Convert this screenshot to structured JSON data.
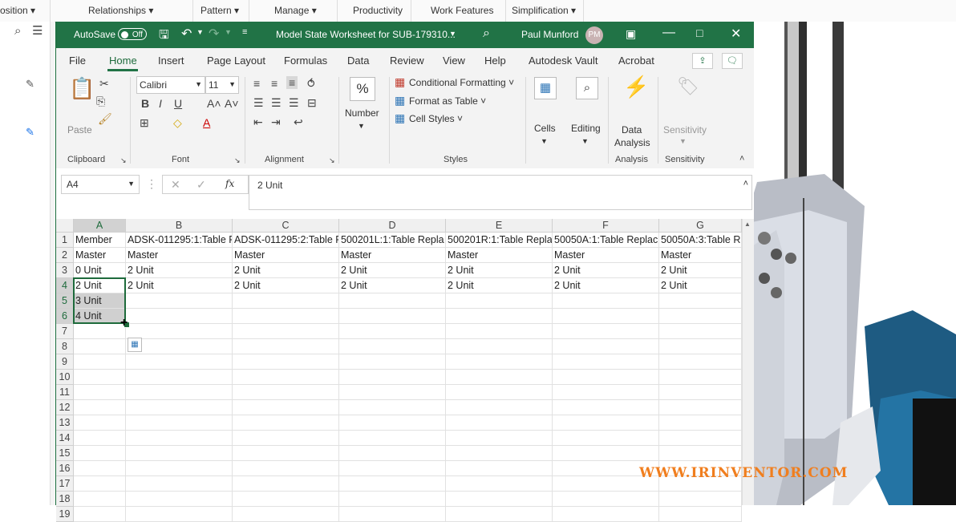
{
  "inventor": {
    "menu": [
      "osition",
      "Relationships",
      "Pattern",
      "Manage",
      "Productivity",
      "Work Features",
      "Simplification"
    ]
  },
  "excel": {
    "autosave_label": "AutoSave",
    "autosave_state": "Off",
    "file_title": "Model State Worksheet for SUB-179310...",
    "user_name": "Paul Munford",
    "user_initials": "PM",
    "tabs": [
      "File",
      "Home",
      "Insert",
      "Page Layout",
      "Formulas",
      "Data",
      "Review",
      "View",
      "Help",
      "Autodesk Vault",
      "Acrobat"
    ],
    "active_tab": "Home",
    "ribbon": {
      "paste": "Paste",
      "clipboard": "Clipboard",
      "font_name": "Calibri",
      "font_size": "11",
      "font": "Font",
      "alignment": "Alignment",
      "number": "Number",
      "conditional_formatting": "Conditional Formatting",
      "format_as_table": "Format as Table",
      "cell_styles": "Cell Styles",
      "styles": "Styles",
      "cells": "Cells",
      "editing": "Editing",
      "data_analysis_1": "Data",
      "data_analysis_2": "Analysis",
      "analysis": "Analysis",
      "sensitivity_btn": "Sensitivity",
      "sensitivity": "Sensitivity"
    },
    "name_box": "A4",
    "formula_value": "2 Unit",
    "columns": [
      "A",
      "B",
      "C",
      "D",
      "E",
      "F",
      "G"
    ],
    "rows": [
      "1",
      "2",
      "3",
      "4",
      "5",
      "6",
      "7",
      "8",
      "9",
      "10",
      "11",
      "12",
      "13",
      "14",
      "15",
      "16",
      "17",
      "18",
      "19"
    ],
    "cells": [
      [
        "Member",
        "ADSK-011295:1:Table F",
        "ADSK-011295:2:Table F",
        "500201L:1:Table Repla",
        "500201R:1:Table Repla",
        "50050A:1:Table Replac",
        "50050A:3:Table R"
      ],
      [
        "Master",
        "Master",
        "Master",
        "Master",
        "Master",
        "Master",
        "Master"
      ],
      [
        "0 Unit",
        "2 Unit",
        "2 Unit",
        "2 Unit",
        "2 Unit",
        "2 Unit",
        "2 Unit"
      ],
      [
        "2 Unit",
        "2 Unit",
        "2 Unit",
        "2 Unit",
        "2 Unit",
        "2 Unit",
        "2 Unit"
      ],
      [
        "3 Unit",
        "",
        "",
        "",
        "",
        "",
        ""
      ],
      [
        "4 Unit",
        "",
        "",
        "",
        "",
        "",
        ""
      ]
    ]
  },
  "watermark": "WWW.IRINVENTOR.COM"
}
